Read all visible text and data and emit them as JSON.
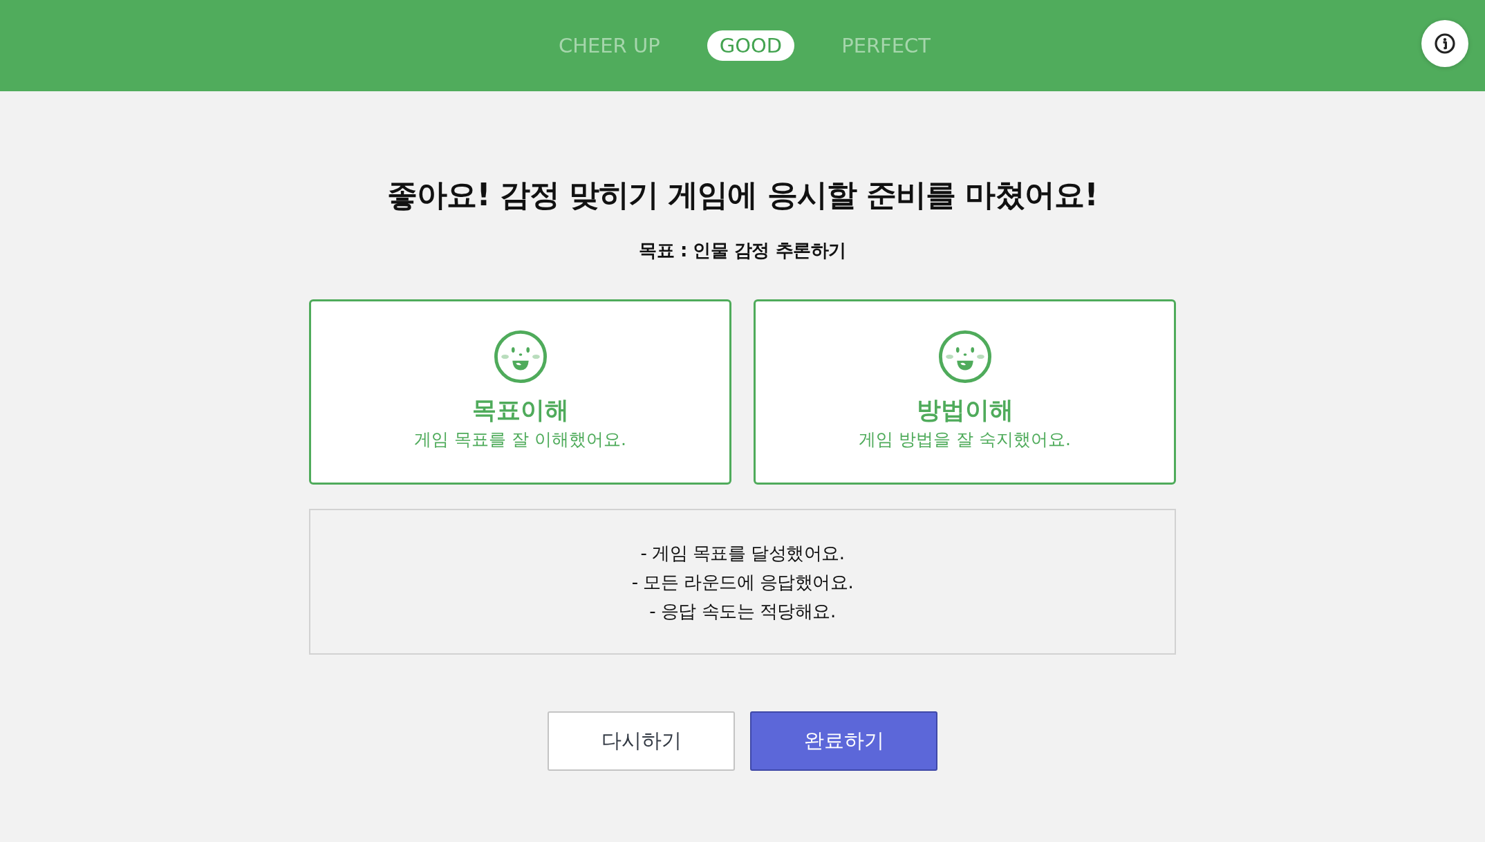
{
  "header": {
    "tabs": [
      {
        "label": "CHEER UP",
        "selected": false
      },
      {
        "label": "GOOD",
        "selected": true
      },
      {
        "label": "PERFECT",
        "selected": false
      }
    ]
  },
  "title": "좋아요! 감정 맞히기 게임에 응시할 준비를 마쳤어요!",
  "goal": "목표 : 인물 감정 추론하기",
  "cards": [
    {
      "title": "목표이해",
      "description": "게임 목표를 잘 이해했어요."
    },
    {
      "title": "방법이해",
      "description": "게임 방법을 잘 숙지했어요."
    }
  ],
  "feedback": [
    "- 게임 목표를 달성했어요.",
    "- 모든 라운드에 응답했어요.",
    "- 응답 속도는 적당해요."
  ],
  "buttons": [
    {
      "label": "다시하기",
      "kind": "secondary"
    },
    {
      "label": "완료하기",
      "kind": "primary"
    }
  ]
}
